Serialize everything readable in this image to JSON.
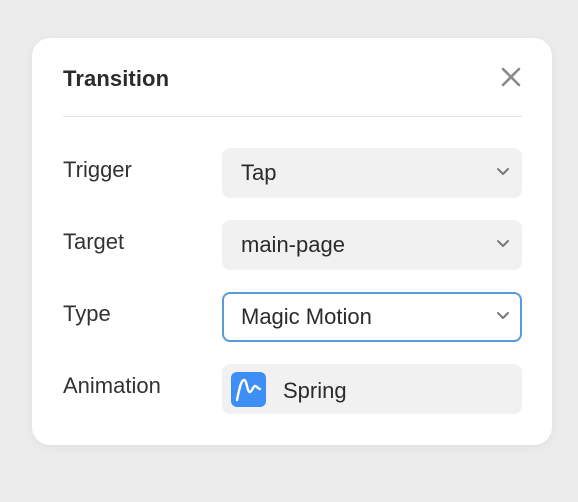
{
  "panel": {
    "title": "Transition",
    "close_icon": "close-icon"
  },
  "fields": {
    "trigger": {
      "label": "Trigger",
      "value": "Tap"
    },
    "target": {
      "label": "Target",
      "value": "main-page"
    },
    "type": {
      "label": "Type",
      "value": "Magic Motion"
    },
    "animation": {
      "label": "Animation",
      "value": "Spring",
      "icon": "spring-curve-icon"
    }
  },
  "colors": {
    "accent": "#3d8ef5",
    "focus_border": "#5a9ad8",
    "field_bg": "#f1f1f1"
  }
}
